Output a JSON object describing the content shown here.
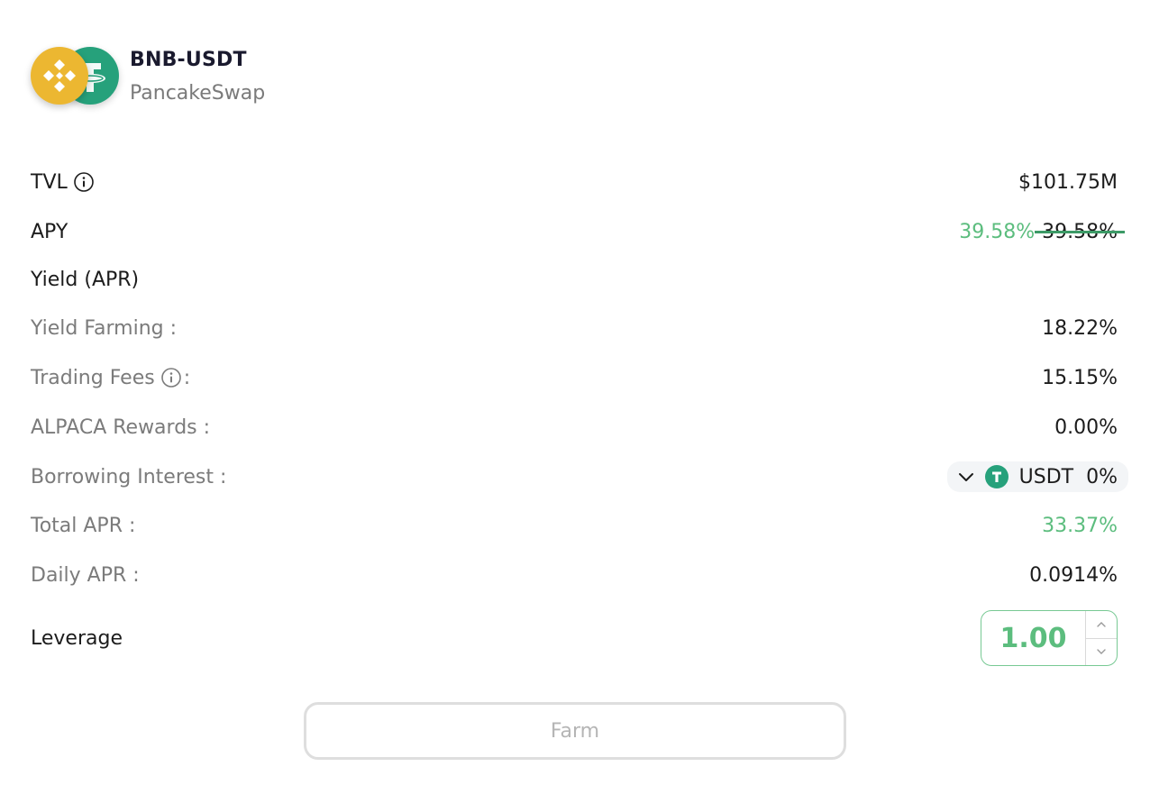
{
  "pair": {
    "name": "BNB-USDT",
    "protocol": "PancakeSwap",
    "token_a_icon": "bnb-icon",
    "token_b_icon": "usdt-icon"
  },
  "stats": {
    "tvl_label": "TVL",
    "tvl_value": "$101.75M",
    "apy_label": "APY",
    "apy_value": "39.58%",
    "apy_old_value": "39.58%",
    "yield_header": "Yield (APR)",
    "yield_farming_label": "Yield Farming :",
    "yield_farming_value": "18.22%",
    "trading_fees_label": "Trading Fees",
    "trading_fees_colon": ":",
    "trading_fees_value": "15.15%",
    "alpaca_rewards_label": "ALPACA Rewards :",
    "alpaca_rewards_value": "0.00%",
    "borrowing_interest_label": "Borrowing Interest :",
    "borrow_token": "USDT",
    "borrow_rate": "0%",
    "total_apr_label": "Total APR :",
    "total_apr_value": "33.37%",
    "daily_apr_label": "Daily APR :",
    "daily_apr_value": "0.0914%"
  },
  "leverage": {
    "label": "Leverage",
    "value": "1.00"
  },
  "actions": {
    "farm_label": "Farm"
  },
  "colors": {
    "accent_green": "#5cbd7e",
    "usdt_green": "#26a17b",
    "bnb_yellow": "#ecb731",
    "muted_text": "#7b7b7b"
  }
}
